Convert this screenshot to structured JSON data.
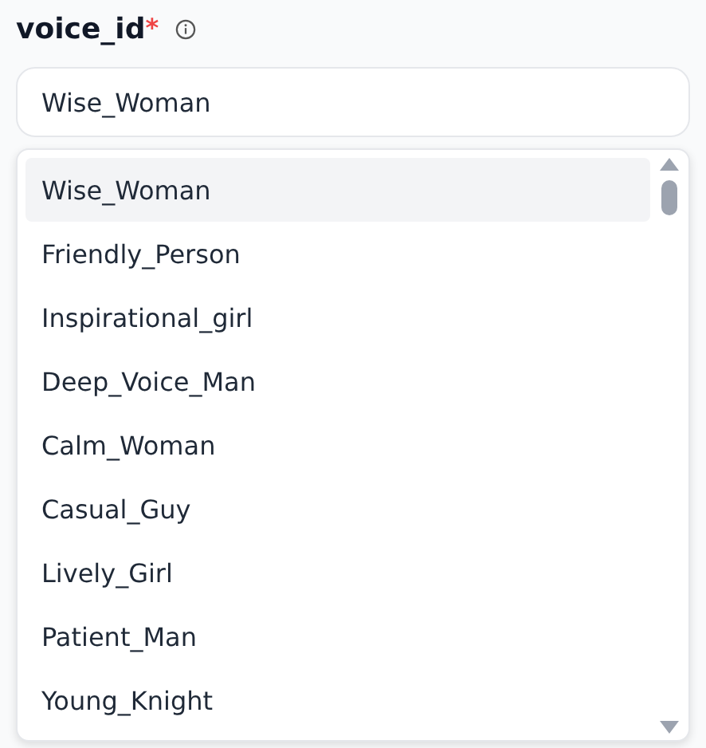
{
  "field": {
    "label": "voice_id",
    "required_mark": "*",
    "value": "Wise_Woman"
  },
  "options": [
    {
      "label": "Wise_Woman",
      "selected": true
    },
    {
      "label": "Friendly_Person",
      "selected": false
    },
    {
      "label": "Inspirational_girl",
      "selected": false
    },
    {
      "label": "Deep_Voice_Man",
      "selected": false
    },
    {
      "label": "Calm_Woman",
      "selected": false
    },
    {
      "label": "Casual_Guy",
      "selected": false
    },
    {
      "label": "Lively_Girl",
      "selected": false
    },
    {
      "label": "Patient_Man",
      "selected": false
    },
    {
      "label": "Young_Knight",
      "selected": false
    }
  ]
}
